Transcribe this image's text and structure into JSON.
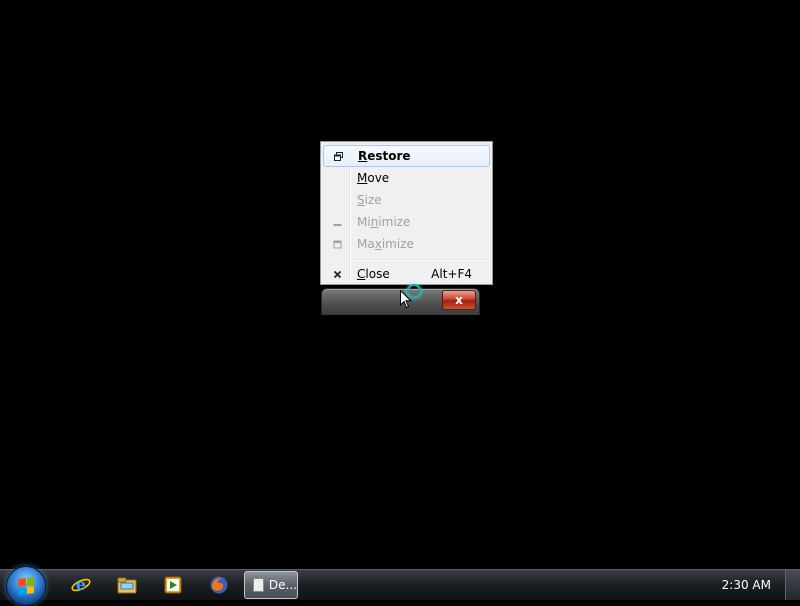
{
  "context_menu": {
    "items": [
      {
        "icon": "restore-icon",
        "label_underlined": "R",
        "label_rest": "estore",
        "shortcut": "",
        "enabled": true,
        "highlighted": true
      },
      {
        "icon": "",
        "label_underlined": "M",
        "label_rest": "ove",
        "shortcut": "",
        "enabled": true,
        "highlighted": false
      },
      {
        "icon": "",
        "label_underlined": "S",
        "label_rest": "ize",
        "shortcut": "",
        "enabled": false,
        "highlighted": false
      },
      {
        "icon": "minimize-icon",
        "label_pre": "Mi",
        "label_underlined": "n",
        "label_rest": "imize",
        "shortcut": "",
        "enabled": false,
        "highlighted": false
      },
      {
        "icon": "maximize-icon",
        "label_pre": "Ma",
        "label_underlined": "x",
        "label_rest": "imize",
        "shortcut": "",
        "enabled": false,
        "highlighted": false
      },
      {
        "icon": "close-icon",
        "label_underlined": "C",
        "label_rest": "lose",
        "shortcut": "Alt+F4",
        "enabled": true,
        "highlighted": false
      }
    ]
  },
  "minimized_window": {
    "close_glyph": "x"
  },
  "taskbar": {
    "pinned": [
      "internet-explorer-icon",
      "windows-explorer-icon",
      "media-player-icon",
      "firefox-icon"
    ],
    "active_task_label": "De...",
    "clock": "2:30 AM"
  },
  "colors": {
    "menu_bg": "#f0f0f0",
    "menu_highlight_border": "#a8c8ec",
    "close_red": "#c8462f",
    "desktop": "#000000"
  }
}
